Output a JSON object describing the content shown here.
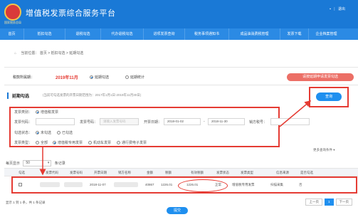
{
  "header": {
    "logo_text": "国家税务总局",
    "title": "增值税发票综合服务平台",
    "user_name": "",
    "logout": "退出"
  },
  "nav": {
    "items": [
      "首页",
      "抵扣勾选",
      "退税勾选",
      "代办退税勾选",
      "进项发票查询",
      "税务事项通知书",
      "成品油消费税管理",
      "发票下载",
      "企业档案管理"
    ]
  },
  "breadcrumb": {
    "label": "当前位置：",
    "path": "首页 > 抵扣勾选 > 延期勾选"
  },
  "period": {
    "label": "税款所属期：",
    "value": "2019年11月",
    "option1": "延期勾选",
    "option2": "延期统计",
    "action_button": "请按延期申请发票勾选"
  },
  "section": {
    "title": "延期勾选",
    "note": "(当前可勾选发票的开票日期范围为：2017年1月1日-2019年11月30日)"
  },
  "query_button": "查询",
  "filters": {
    "invoice_type_label": "发票类别：",
    "invoice_type_value": "增值税发票",
    "code_label": "发票代码：",
    "number_label": "发票号码：",
    "number_value": "请输入发票号码",
    "date_label": "开票日期：",
    "date_from": "2018-01-02",
    "date_to": "2018-11-30",
    "seller_tax_label": "销方税号：",
    "status_label": "勾选状态：",
    "status_opt1": "未勾选",
    "status_opt2": "已勾选",
    "kind_label": "发票类型：",
    "kind_opt1": "全部",
    "kind_opt2": "增值税专用发票",
    "kind_opt3": "机动车发票",
    "kind_opt4": "通行费电子发票"
  },
  "more_link": "更多查询条件 ▾",
  "page_size": {
    "prefix": "每页显示",
    "value": "50",
    "suffix": "条记录"
  },
  "table": {
    "columns": [
      "勾选",
      "发票代码",
      "发票号码",
      "开票日期",
      "销方名称",
      "金额",
      "税额",
      "有效税额",
      "发票状态",
      "发票类型",
      "信息来源",
      "是否勾选"
    ],
    "rows": [
      {
        "date": "2018-11-07",
        "amount": "40867",
        "tax": "1226.01",
        "valid_tax": "1226.01",
        "status": "正常",
        "type": "增值税专用发票",
        "source": "扫描采集",
        "checked": "否"
      }
    ]
  },
  "footer": {
    "summary": "显示 1 到 1 条，共 1 条记录",
    "prev": "上一页",
    "page": "1",
    "next": "下一页",
    "submit": "提交"
  },
  "colors": {
    "header_blue": "#1a79d6",
    "nav_blue": "#2b8ae4",
    "annotation_red": "#e53b33",
    "period_red": "#e53b33",
    "button_blue": "#1f8fef"
  }
}
